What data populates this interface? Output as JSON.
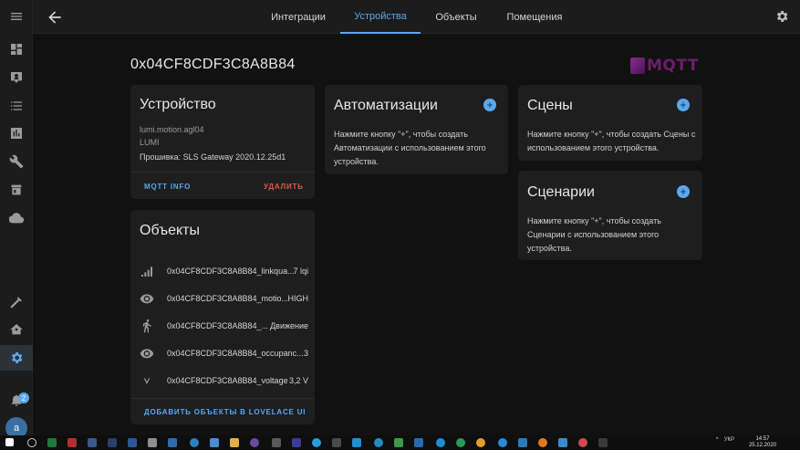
{
  "window": {
    "title": "0x04CF8CDF3C8A8B84"
  },
  "sidebar": {
    "items": [
      {
        "icon": "menu-icon"
      },
      {
        "icon": "dashboard-icon"
      },
      {
        "icon": "map-icon"
      },
      {
        "icon": "logbook-icon"
      },
      {
        "icon": "history-icon"
      },
      {
        "icon": "wrench-icon"
      },
      {
        "icon": "hacs-icon"
      },
      {
        "icon": "cloud-icon"
      },
      {
        "icon": "hammer-icon"
      },
      {
        "icon": "home-gear-icon"
      },
      {
        "icon": "gear-icon"
      }
    ],
    "notifications_count": "2",
    "avatar_letter": "a"
  },
  "tabs": [
    {
      "label": "Интеграции"
    },
    {
      "label": "Устройства",
      "active": true
    },
    {
      "label": "Объекты"
    },
    {
      "label": "Помещения"
    }
  ],
  "page": {
    "title": "0x04CF8CDF3C8A8B84",
    "logo_text": "MQTT"
  },
  "device_card": {
    "title": "Устройство",
    "model": "lumi.motion.agl04",
    "manufacturer": "LUMI",
    "firmware": "Прошивка: SLS Gateway 2020.12.25d1",
    "mqtt_info_label": "MQTT INFO",
    "delete_label": "УДАЛИТЬ"
  },
  "entities_card": {
    "title": "Объекты",
    "rows": [
      {
        "icon": "signal-icon",
        "name": "0x04CF8CDF3C8A8B84_linkqua...",
        "state": "7 lqi"
      },
      {
        "icon": "eye-icon",
        "name": "0x04CF8CDF3C8A8B84_motio...",
        "state": "HIGH"
      },
      {
        "icon": "walk-icon",
        "name": "0x04CF8CDF3C8A8B84_...",
        "state": "Движение"
      },
      {
        "icon": "eye-icon",
        "name": "0x04CF8CDF3C8A8B84_occupanc...",
        "state": "3"
      },
      {
        "icon": "voltage-icon",
        "name": "0x04CF8CDF3C8A8B84_voltage",
        "state": "3,2 V"
      }
    ],
    "add_to_lovelace_label": "ДОБАВИТЬ ОБЪЕКТЫ В LOVELACE UI"
  },
  "automations_card": {
    "title": "Автоматизации",
    "text": "Нажмите кнопку \"+\", чтобы создать Автоматизации с использованием этого устройства."
  },
  "scenes_card": {
    "title": "Сцены",
    "text": "Нажмите кнопку \"+\", чтобы создать Сцены с использованием этого устройства."
  },
  "scripts_card": {
    "title": "Сценарии",
    "text": "Нажмите кнопку \"+\", чтобы создать Сценарии с использованием этого устройства."
  },
  "colors": {
    "accent": "#5aa7f2",
    "danger": "#e05a4a",
    "background": "#111111",
    "card": "#1e1e1e"
  },
  "taskbar": {
    "lang": "УКР",
    "time": "14:57",
    "date": "25.12.2020"
  }
}
